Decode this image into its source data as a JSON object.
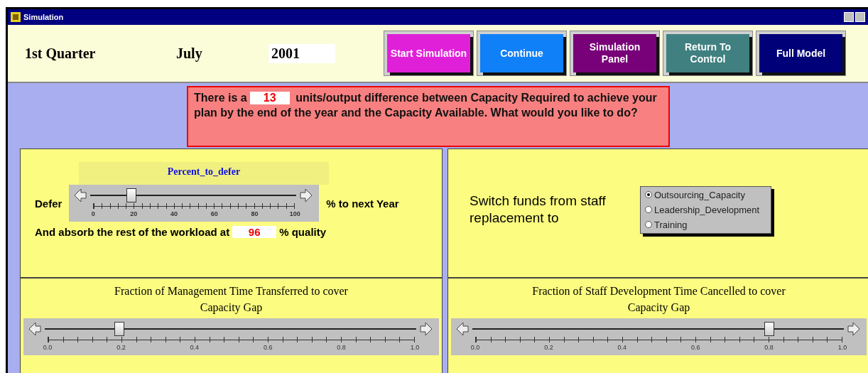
{
  "window": {
    "title": "Simulation"
  },
  "header": {
    "quarter": "1st Quarter",
    "month": "July",
    "year": "2001"
  },
  "buttons": [
    {
      "label": "Start Simulation",
      "color": "#e020d8"
    },
    {
      "label": "Continue",
      "color": "#1080f8"
    },
    {
      "label": "Simulation Panel",
      "color": "#780078"
    },
    {
      "label": "Return To Control",
      "color": "#408080"
    },
    {
      "label": "Full Model",
      "color": "#000078"
    }
  ],
  "message": {
    "before": "There is a",
    "value": "13",
    "after": "units/output difference between Capacity Required to achieve your plan by the end of the year and the Capacity Available. What would you like to do?"
  },
  "defer_panel": {
    "slider_title": "Percent_to_defer",
    "label_before": "Defer",
    "label_after": "% to next Year",
    "level": 0.2,
    "ticks": [
      "0",
      "20",
      "40",
      "60",
      "80",
      "100"
    ],
    "quality_before": "And absorb the rest of the workload at",
    "quality_value": "96",
    "quality_after": "% quality"
  },
  "funds_panel": {
    "label": "Switch funds from staff replacement to",
    "options": [
      {
        "label": "Outsourcing_Capacity",
        "selected": true
      },
      {
        "label": "Leadership_Development",
        "selected": false
      },
      {
        "label": "Training",
        "selected": false
      }
    ]
  },
  "sliders": [
    {
      "title": "Fraction of Management Time Transferred to cover Capacity Gap",
      "level": 0.2,
      "ticks": [
        "0.0",
        "0.2",
        "0.4",
        "0.6",
        "0.8",
        "1.0"
      ]
    },
    {
      "title": "Fraction of Staff Development Time Cancelled to cover Capacity Gap",
      "level": 0.8,
      "ticks": [
        "0.0",
        "0.2",
        "0.4",
        "0.6",
        "0.8",
        "1.0"
      ]
    }
  ]
}
